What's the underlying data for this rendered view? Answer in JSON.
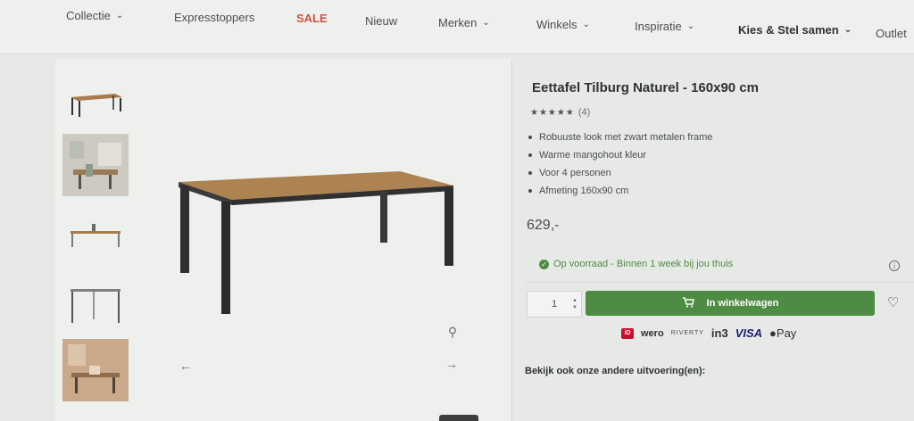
{
  "nav": [
    {
      "label": "Collectie",
      "chevron": true
    },
    {
      "label": "Expresstoppers",
      "chevron": false
    },
    {
      "label": "SALE",
      "chevron": false
    },
    {
      "label": "Nieuw",
      "chevron": false
    },
    {
      "label": "Merken",
      "chevron": true
    },
    {
      "label": "Winkels",
      "chevron": true
    },
    {
      "label": "Inspiratie",
      "chevron": true
    },
    {
      "label": "Kies & Stel samen",
      "chevron": true
    },
    {
      "label": "Outlet",
      "chevron": false
    }
  ],
  "product": {
    "title": "Eettafel Tilburg Naturel - 160x90 cm",
    "stars": "★★★★★",
    "review_count": "(4)",
    "bullets": [
      "Robuuste look met zwart metalen frame",
      "Warme mangohout kleur",
      "Voor 4 personen",
      "Afmeting 160x90 cm"
    ],
    "price": "629,-",
    "stock": "Op voorraad - Binnen 1 week bij jou thuis",
    "quantity": "1",
    "cart_label": "In winkelwagen",
    "other_variants_label": "Bekijk ook onze andere uitvoering(en):"
  },
  "payments": {
    "wero": "wero",
    "riverty": "RIVERTY",
    "in3": "in3",
    "visa": "VISA",
    "apple_pay": "Pay"
  },
  "colors": {
    "accent_green": "#4e8c43",
    "sale_red": "#c9563d"
  }
}
